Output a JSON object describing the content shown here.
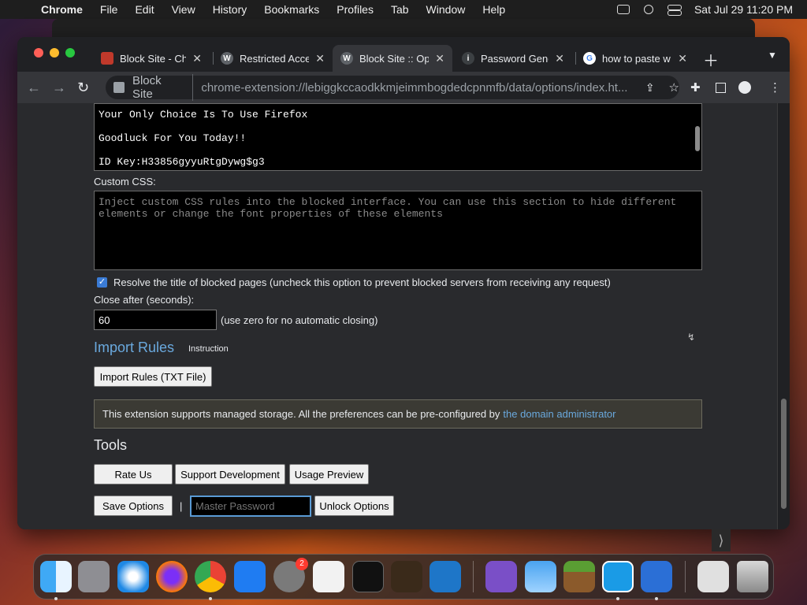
{
  "menubar": {
    "app": "Chrome",
    "items": [
      "File",
      "Edit",
      "View",
      "History",
      "Bookmarks",
      "Profiles",
      "Tab",
      "Window",
      "Help"
    ],
    "datetime": "Sat Jul 29  11:20 PM"
  },
  "tabs": [
    {
      "title": "Block Site - Chr",
      "active": false
    },
    {
      "title": "Restricted Acce",
      "active": false
    },
    {
      "title": "Block Site :: Op",
      "active": true
    },
    {
      "title": "Password Gene",
      "active": false
    },
    {
      "title": "how to paste w",
      "active": false
    }
  ],
  "toolbar": {
    "site_name": "Block Site",
    "url": "chrome-extension://lebiggkccaodkkmjeimmbogdedcpnmfb/data/options/index.ht..."
  },
  "message_box": {
    "lines": [
      "Your Only Choice Is To Use Firefox",
      "Goodluck For You Today!!",
      "ID Key:H33856gyyuRtgDywg$g3"
    ]
  },
  "custom_css": {
    "label": "Custom CSS:",
    "placeholder": "Inject custom CSS rules into the blocked interface. You can use this section to hide different elements or change the font properties of these elements"
  },
  "resolve_title": {
    "checked": true,
    "label": "Resolve the title of blocked pages (uncheck this option to prevent blocked servers from receiving any request)"
  },
  "close_after": {
    "label": "Close after (seconds):",
    "value": "60",
    "hint": "(use zero for no automatic closing)"
  },
  "import_rules": {
    "heading": "Import Rules",
    "instruction": "Instruction",
    "button": "Import Rules (TXT File)"
  },
  "notice": {
    "text": "This extension supports managed storage. All the preferences can be pre-configured by",
    "link": "the domain administrator"
  },
  "tools": {
    "heading": "Tools",
    "buttons": [
      "Rate Us",
      "Support Development",
      "Usage Preview"
    ]
  },
  "footer": {
    "save": "Save Options",
    "separator": "|",
    "password_placeholder": "Master Password",
    "unlock": "Unlock Options"
  },
  "dock": {
    "settings_badge": "2"
  },
  "colors": {
    "accent_link": "#6aa9de",
    "page_bg": "#292a2d",
    "checkbox": "#3a7bd5"
  }
}
